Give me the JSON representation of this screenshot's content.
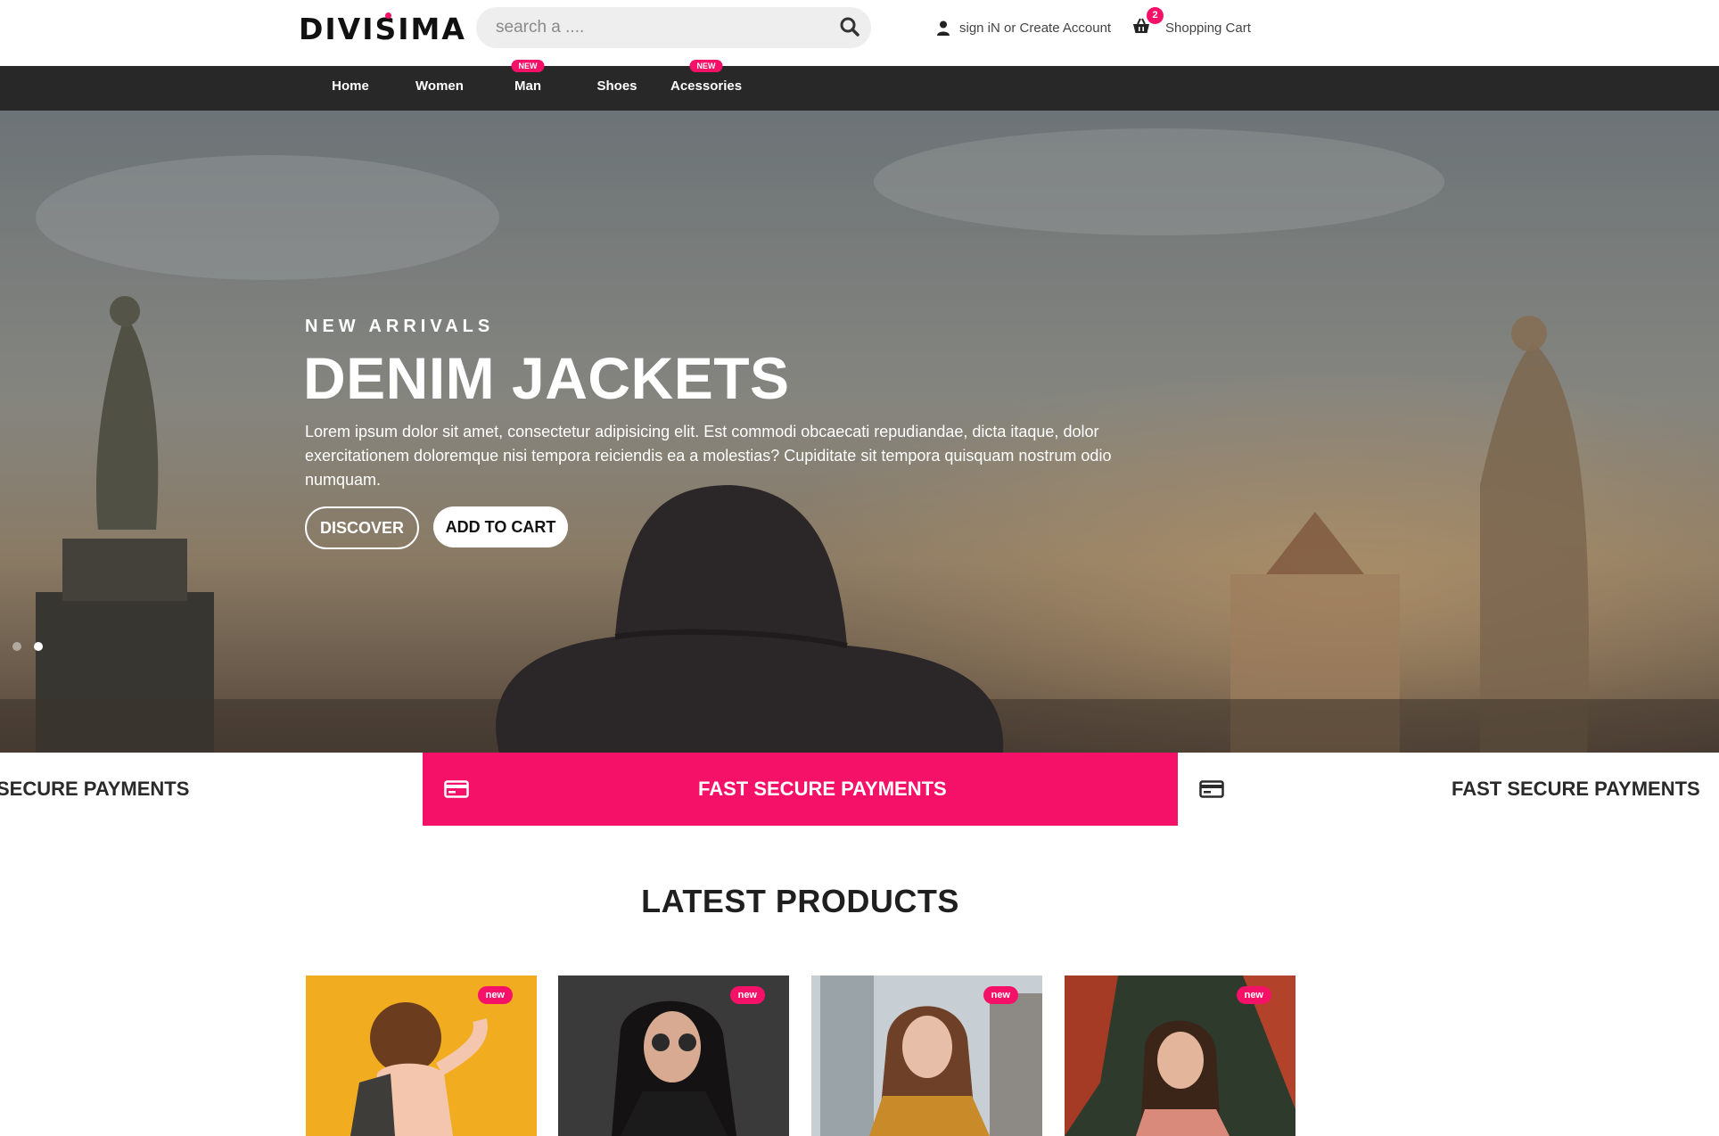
{
  "brand": {
    "name": "DIVISIMA",
    "accent": "#f51167"
  },
  "search": {
    "placeholder": "search a ...."
  },
  "account": {
    "label": "sign iN or Create Account"
  },
  "cart": {
    "label": "Shopping Cart",
    "count": "2"
  },
  "nav": {
    "items": [
      {
        "label": "Home",
        "tag": ""
      },
      {
        "label": "Women",
        "tag": ""
      },
      {
        "label": "Man",
        "tag": "NEW"
      },
      {
        "label": "Shoes",
        "tag": ""
      },
      {
        "label": "Acessories",
        "tag": "NEW"
      }
    ]
  },
  "hero": {
    "eyebrow": "NEW ARRIVALS",
    "title": "DENIM JACKETS",
    "text": "Lorem ipsum dolor sit amet, consectetur adipisicing elit. Est commodi obcaecati repudiandae, dicta itaque, dolor exercitationem doloremque nisi tempora reiciendis ea a molestias? Cupiditate sit tempora quisquam nostrum odio numquam.",
    "discover_label": "DISCOVER",
    "add_to_cart_label": "ADD TO CART",
    "slide_count": 2,
    "active_slide": 2
  },
  "features": {
    "items": [
      {
        "label": "SECURE PAYMENTS",
        "icon": "card-icon"
      },
      {
        "label": "FAST SECURE PAYMENTS",
        "icon": "credit-card-icon",
        "active": true
      },
      {
        "label": "FAST SECURE PAYMENTS",
        "icon": "credit-card-icon"
      }
    ]
  },
  "latest": {
    "title": "LATEST PRODUCTS",
    "products": [
      {
        "badge": "new"
      },
      {
        "badge": "new"
      },
      {
        "badge": "new"
      },
      {
        "badge": "new"
      }
    ]
  }
}
